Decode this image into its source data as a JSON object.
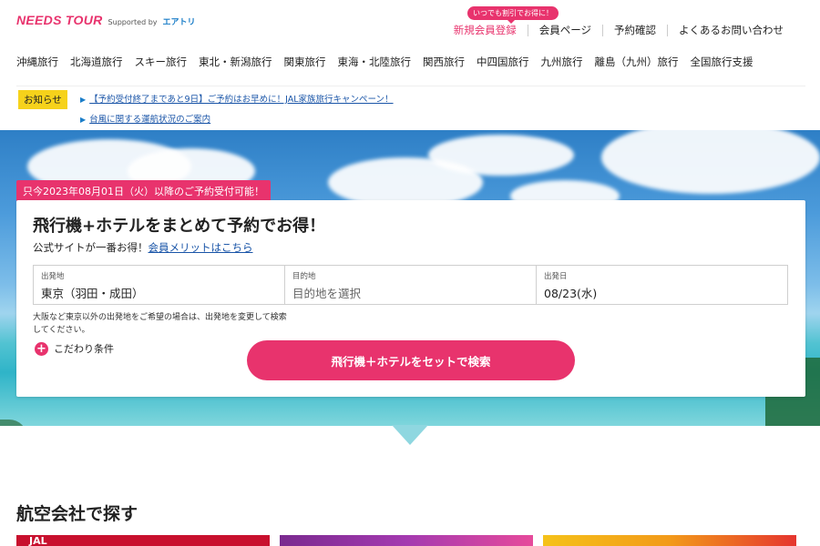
{
  "brand": {
    "logo": "NEEDS TOUR",
    "supported_by": "Supported by",
    "partner": "エアトリ"
  },
  "header": {
    "promo_bubble": "いつでも割引でお得に！",
    "links": {
      "register": "新規会員登録",
      "member_page": "会員ページ",
      "reservation_check": "予約確認",
      "faq": "よくあるお問い合わせ"
    }
  },
  "nav": {
    "items": [
      "沖縄旅行",
      "北海道旅行",
      "スキー旅行",
      "東北・新潟旅行",
      "関東旅行",
      "東海・北陸旅行",
      "関西旅行",
      "中四国旅行",
      "九州旅行",
      "離島（九州）旅行",
      "全国旅行支援"
    ]
  },
  "notices": {
    "label": "お知らせ",
    "items": [
      "【予約受付終了まであと9日】ご予約はお早めに！JAL家族旅行キャンペーン！",
      "台風に関する運航状況のご案内"
    ]
  },
  "hero": {
    "badge": "只今2023年08月01日（火）以降のご予約受付可能！"
  },
  "search": {
    "title": "飛行機+ホテルをまとめて予約でお得！",
    "subtitle_prefix": "公式サイトが一番お得！",
    "subtitle_link": "会員メリットはこちら",
    "fields": {
      "departure": {
        "label": "出発地",
        "value": "東京（羽田・成田）"
      },
      "destination": {
        "label": "目的地",
        "placeholder": "目的地を選択"
      },
      "date": {
        "label": "出発日",
        "value": "08/23(水)"
      }
    },
    "note": "大阪など東京以外の出発地をご希望の場合は、出発地を変更して検索してください。",
    "options_label": "こだわり条件",
    "submit_label": "飛行機＋ホテルをセットで検索"
  },
  "airlines": {
    "section_title": "航空会社で探す",
    "banners": [
      "JAL",
      "",
      ""
    ]
  },
  "colors": {
    "accent": "#e8336d",
    "notice_label": "#f6d21b",
    "link": "#1a55a8"
  }
}
